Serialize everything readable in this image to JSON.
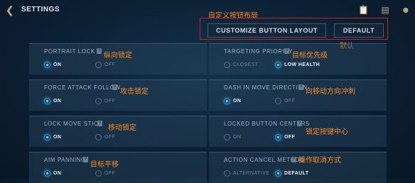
{
  "header": {
    "title": "SETTINGS",
    "back_icon": "back-arrow-icon",
    "icons": [
      "clipboard-icon",
      "chat-icon",
      "people-icon"
    ]
  },
  "buttons": {
    "customize": "CUSTOMIZE BUTTON LAYOUT",
    "default": "DEFAULT"
  },
  "annotations": {
    "customize_layout": "自定义按钮布局",
    "default": "默认",
    "portrait_lock": "纵向锁定",
    "targeting_priority": "目标优先级",
    "force_attack": "攻击锁定",
    "dash_direction": "向移动方向冲刺",
    "lock_move_stick": "移动锁定",
    "locked_centers": "锁定按键中心",
    "aim_panning": "目标平移",
    "action_cancel": "操作取消方式"
  },
  "settings": {
    "portrait_lock": {
      "label": "PORTRAIT LOCK",
      "opt1": "ON",
      "opt2": "OFF",
      "selected": "ON"
    },
    "targeting_priority": {
      "label": "TARGETING PRIORITY",
      "opt1": "CLOSEST",
      "opt2": "LOW HEALTH",
      "selected": "LOW HEALTH"
    },
    "force_attack": {
      "label": "FORCE ATTACK FOLLOW",
      "opt1": "ON",
      "opt2": "OFF",
      "selected": "ON"
    },
    "dash_direction": {
      "label": "DASH IN MOVE DIRECTION",
      "opt1": "ON",
      "opt2": "OFF",
      "selected": "ON"
    },
    "lock_move_stick": {
      "label": "LOCK MOVE STICK",
      "opt1": "ON",
      "opt2": "OFF",
      "selected": "ON"
    },
    "locked_centers": {
      "label": "LOCKED BUTTON CENTERS",
      "opt1": "ON",
      "opt2": "OFF",
      "selected": "OFF"
    },
    "aim_panning": {
      "label": "AIM PANNING",
      "opt1": "ON",
      "opt2": "OFF",
      "selected": "ON"
    },
    "action_cancel": {
      "label": "ACTION CANCEL METHOD",
      "opt1": "ALTERNATIVE",
      "opt2": "DEFAULT",
      "selected": "DEFAULT"
    }
  },
  "colors": {
    "accent": "#3aa0d8",
    "annotation": "#ff8a1f",
    "highlight_box": "#d01f1f",
    "gold_icon": "#c9b37a"
  }
}
